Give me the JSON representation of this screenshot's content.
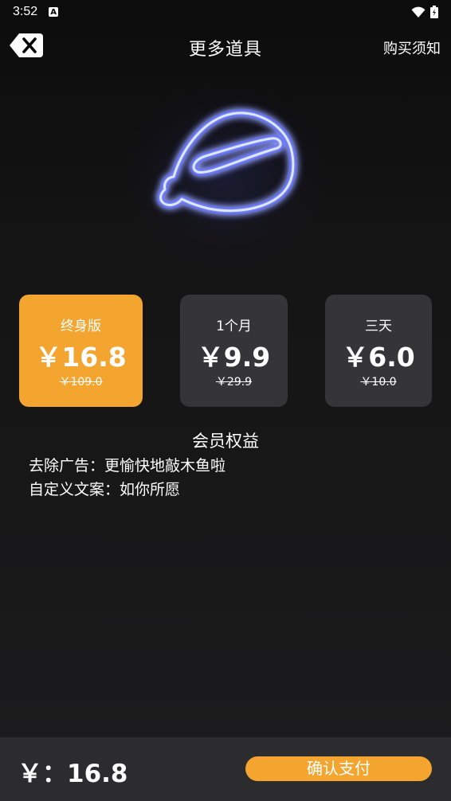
{
  "status_bar": {
    "time": "3:52",
    "notification_icon": "A",
    "icons": [
      "wifi-icon",
      "battery-icon"
    ]
  },
  "header": {
    "title": "更多道具",
    "right_link": "购买须知",
    "back_icon": "close-icon"
  },
  "hero": {
    "icon": "neon-wooden-fish-icon",
    "neon_color": "#3b5bff"
  },
  "plans": [
    {
      "name": "终身版",
      "price": "￥16.8",
      "original_price": "￥109.0",
      "selected": true
    },
    {
      "name": "1个月",
      "price": "￥9.9",
      "original_price": "￥29.9",
      "selected": false
    },
    {
      "name": "三天",
      "price": "￥6.0",
      "original_price": "￥10.0",
      "selected": false
    }
  ],
  "benefits": {
    "title": "会员权益",
    "items": [
      "去除广告：更愉快地敲木鱼啦",
      "自定义文案：如你所愿"
    ]
  },
  "footer": {
    "total": "￥：16.8",
    "pay_label": "确认支付"
  },
  "colors": {
    "accent": "#f3a530",
    "card": "#353537",
    "background": "#141414",
    "bottom_bar": "#2c2c2e"
  }
}
